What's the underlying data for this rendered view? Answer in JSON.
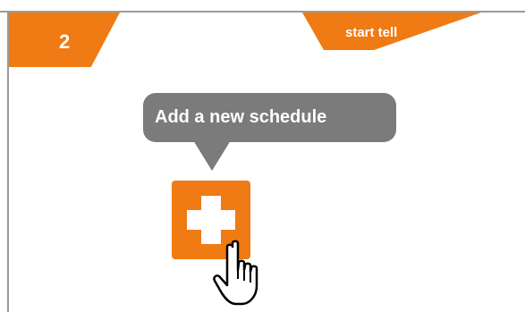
{
  "step": {
    "number": "2",
    "title": "start tell",
    "accent_color": "#f07a13"
  },
  "tooltip": {
    "text": "Add a new schedule",
    "background_color": "#7b7b7b"
  },
  "add_button": {
    "icon": "plus-icon"
  },
  "cursor": {
    "icon": "hand-pointer-icon"
  }
}
